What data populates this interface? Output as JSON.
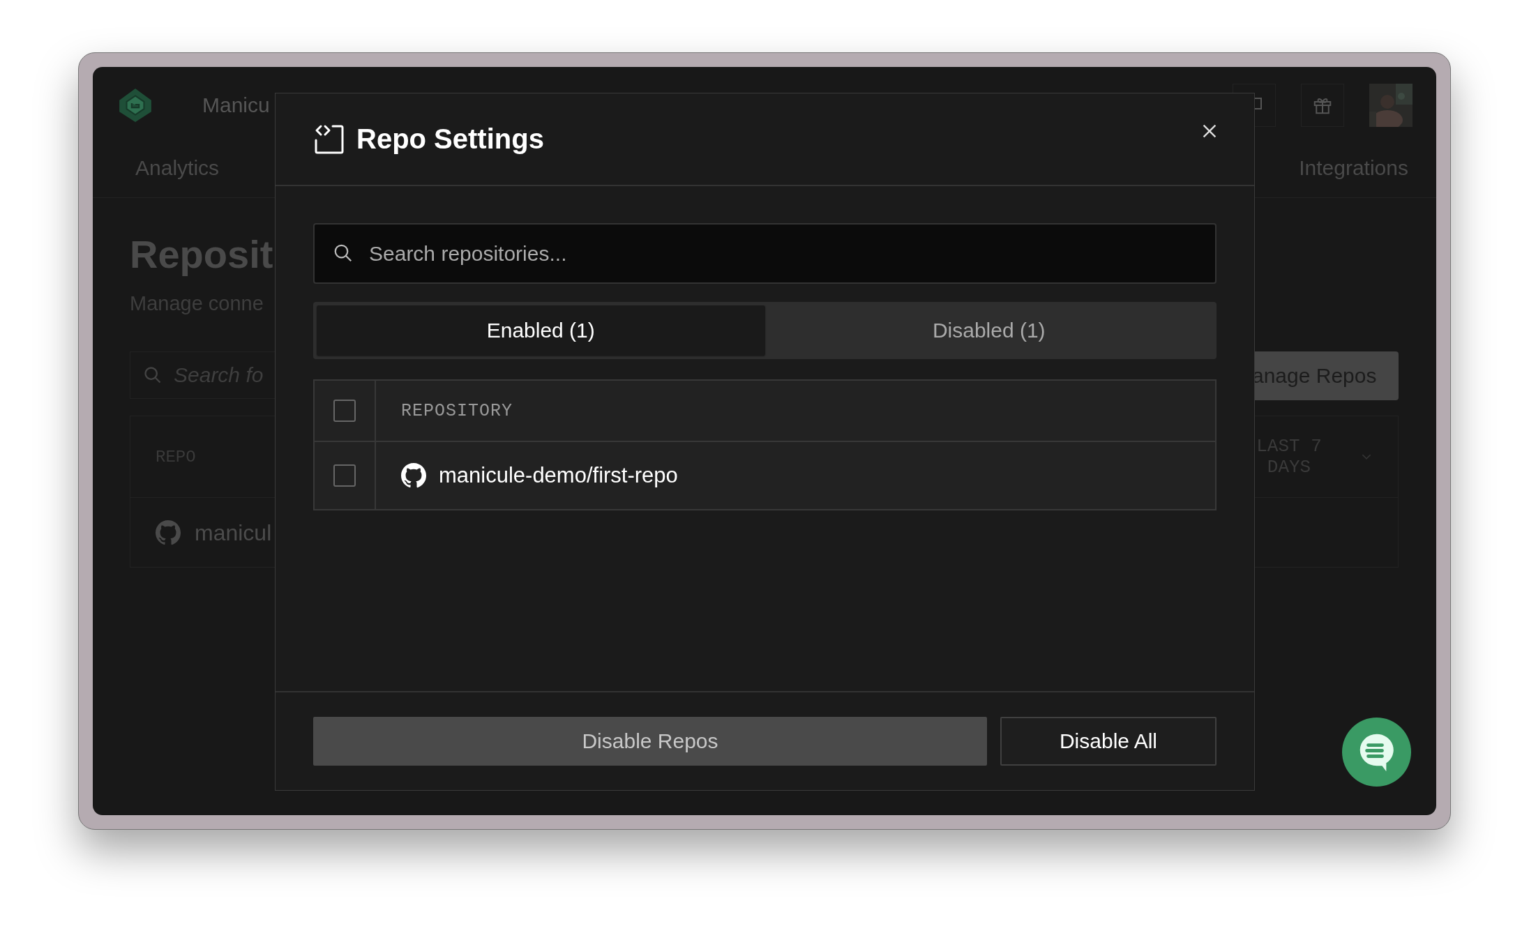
{
  "app": {
    "brand": "Manicu",
    "nav_tabs": [
      {
        "label": "Analytics",
        "selected": false
      },
      {
        "label": "Integrations",
        "selected": false
      }
    ],
    "heading": "Reposit",
    "subheading": "Manage conne",
    "search": {
      "placeholder": "Search fo"
    },
    "manage_button": "anage Repos",
    "table": {
      "columns": [
        "REPO",
        "LAST 7 DAYS"
      ],
      "rows": [
        {
          "name": "manicul"
        }
      ]
    }
  },
  "modal": {
    "title": "Repo Settings",
    "search": {
      "placeholder": "Search repositories..."
    },
    "tabs": [
      {
        "label": "Enabled (1)",
        "selected": true
      },
      {
        "label": "Disabled (1)",
        "selected": false
      }
    ],
    "table": {
      "header": {
        "label": "REPOSITORY",
        "checked": false
      },
      "rows": [
        {
          "name": "manicule-demo/first-repo",
          "checked": false
        }
      ]
    },
    "buttons": [
      {
        "label": "Disable Repos",
        "kind": "primary"
      },
      {
        "label": "Disable All",
        "kind": "secondary"
      }
    ]
  }
}
